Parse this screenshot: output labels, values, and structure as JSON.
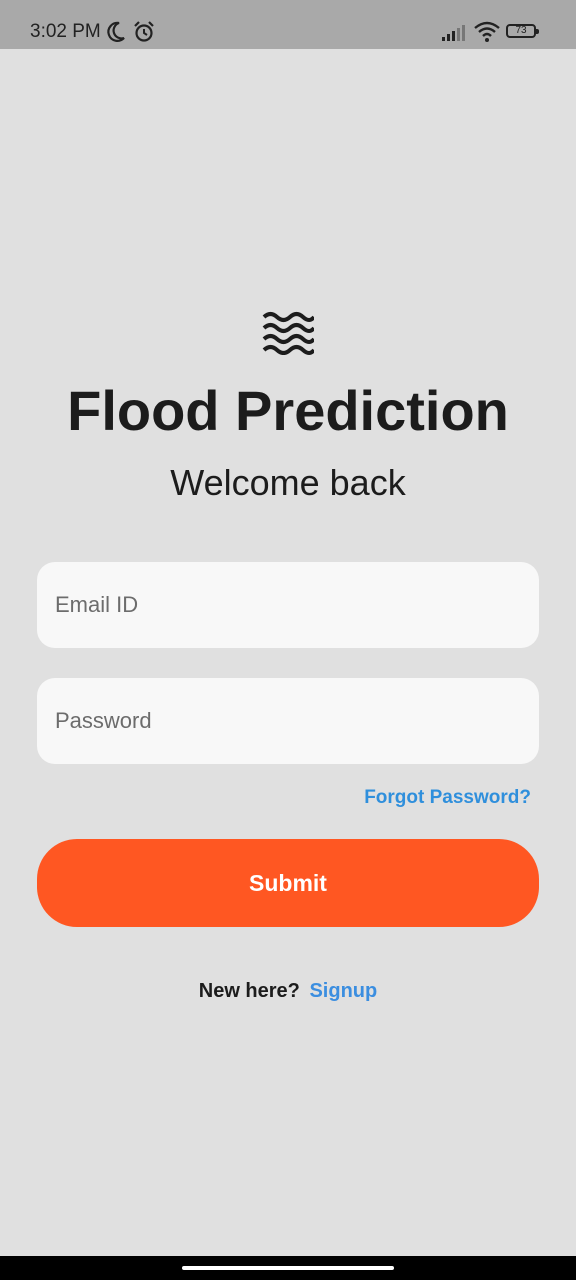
{
  "status_bar": {
    "time": "3:02 PM",
    "battery_level": "73",
    "icons": [
      "moon-icon",
      "alarm-icon",
      "signal-icon",
      "wifi-icon",
      "battery-icon"
    ]
  },
  "app": {
    "logo_icon": "waves-icon",
    "title": "Flood Prediction",
    "subtitle": "Welcome back"
  },
  "form": {
    "email_placeholder": "Email ID",
    "password_placeholder": "Password",
    "forgot_label": "Forgot Password?",
    "submit_label": "Submit"
  },
  "footer": {
    "prompt": "New here?",
    "signup_label": "Signup"
  },
  "colors": {
    "background": "#e0e0e0",
    "status_bar": "#a9a9a9",
    "accent": "#ff5722",
    "link": "#2f8fdc"
  }
}
